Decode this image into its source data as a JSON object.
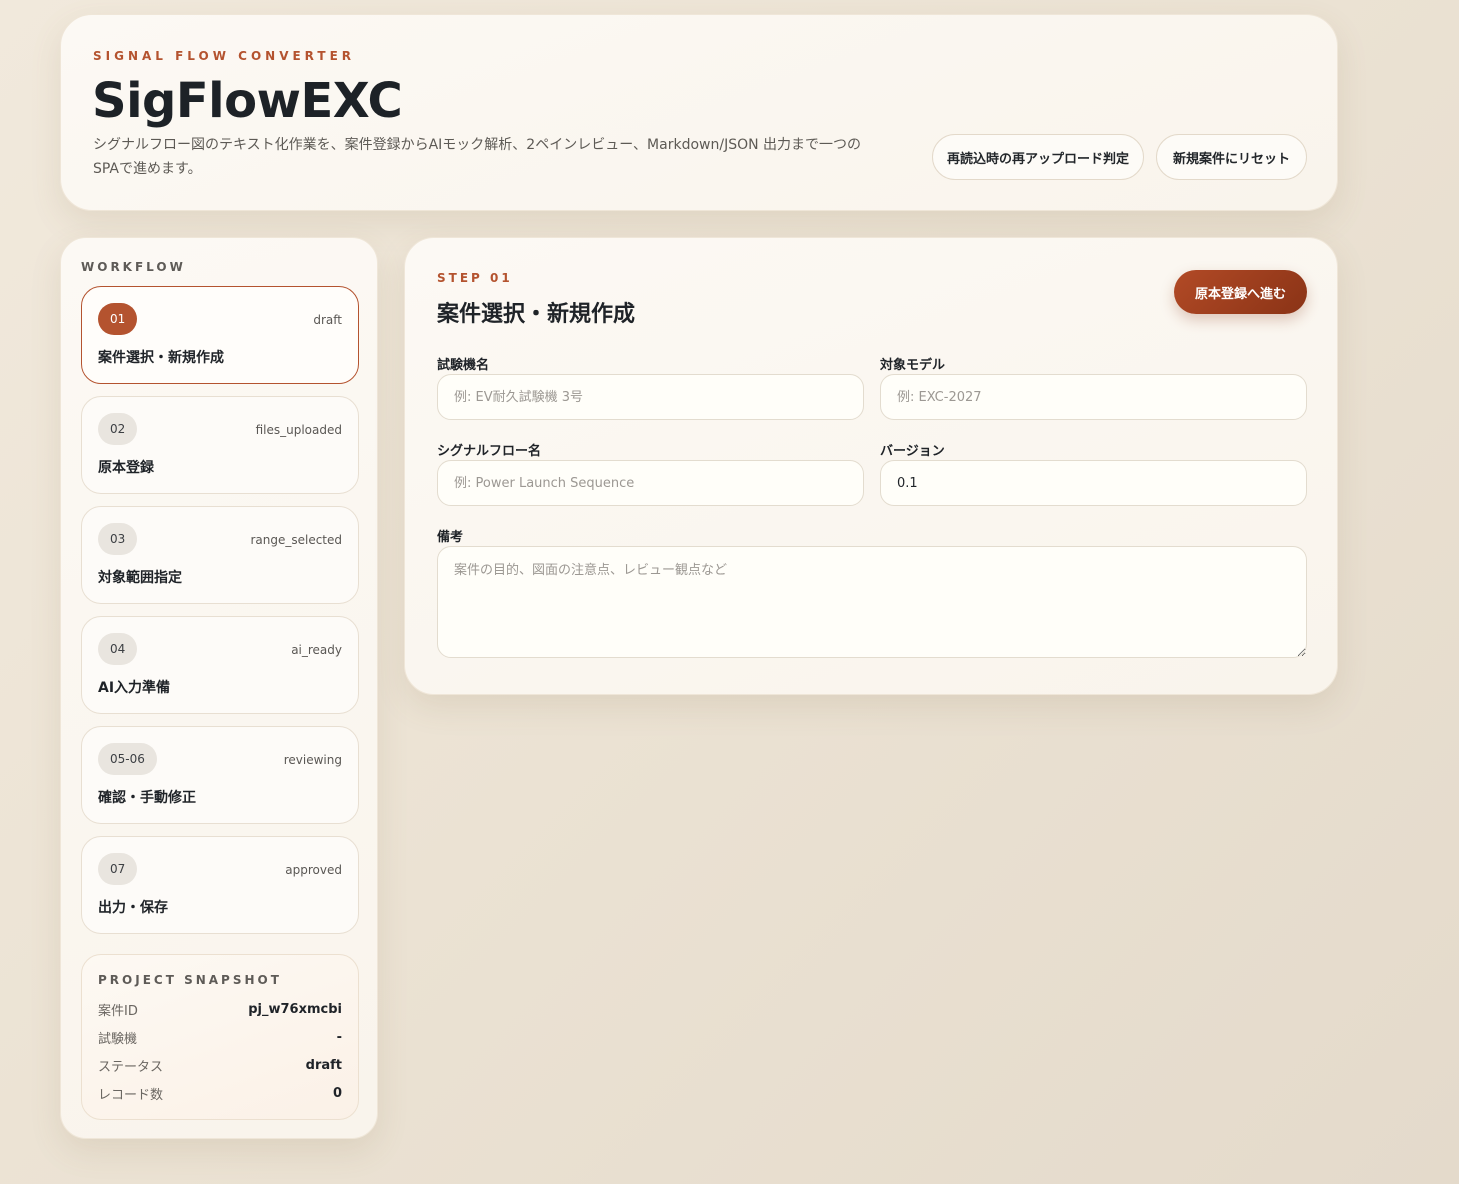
{
  "header": {
    "eyebrow": "SIGNAL FLOW CONVERTER",
    "title": "SigFlowEXC",
    "description": "シグナルフロー図のテキスト化作業を、案件登録からAIモック解析、2ペインレビュー、Markdown/JSON 出力まで一つのSPAで進めます。",
    "reupload_button": "再読込時の再アップロード判定",
    "reset_button": "新規案件にリセット"
  },
  "sidebar": {
    "heading": "WORKFLOW",
    "steps": [
      {
        "num": "01",
        "status": "draft",
        "label": "案件選択・新規作成",
        "active": true
      },
      {
        "num": "02",
        "status": "files_uploaded",
        "label": "原本登録"
      },
      {
        "num": "03",
        "status": "range_selected",
        "label": "対象範囲指定"
      },
      {
        "num": "04",
        "status": "ai_ready",
        "label": "AI入力準備"
      },
      {
        "num": "05-06",
        "status": "reviewing",
        "label": "確認・手動修正"
      },
      {
        "num": "07",
        "status": "approved",
        "label": "出力・保存"
      }
    ],
    "snapshot": {
      "heading": "PROJECT SNAPSHOT",
      "rows": [
        {
          "key": "案件ID",
          "value": "pj_w76xmcbi"
        },
        {
          "key": "試験機",
          "value": "-"
        },
        {
          "key": "ステータス",
          "value": "draft"
        },
        {
          "key": "レコード数",
          "value": "0"
        }
      ]
    }
  },
  "main": {
    "eyebrow": "STEP 01",
    "title": "案件選択・新規作成",
    "next_button": "原本登録へ進む",
    "fields": {
      "machine_name": {
        "label": "試験機名",
        "placeholder": "例: EV耐久試験機 3号",
        "value": ""
      },
      "target_model": {
        "label": "対象モデル",
        "placeholder": "例: EXC-2027",
        "value": ""
      },
      "flow_name": {
        "label": "シグナルフロー名",
        "placeholder": "例: Power Launch Sequence",
        "value": ""
      },
      "version": {
        "label": "バージョン",
        "placeholder": "",
        "value": "0.1"
      },
      "notes": {
        "label": "備考",
        "placeholder": "案件の目的、図面の注意点、レビュー観点など",
        "value": ""
      }
    }
  },
  "colors": {
    "accent": "#b4532f",
    "accent_dark": "#8a3316",
    "background": "#ede4d6",
    "card": "#fbf7f1"
  }
}
